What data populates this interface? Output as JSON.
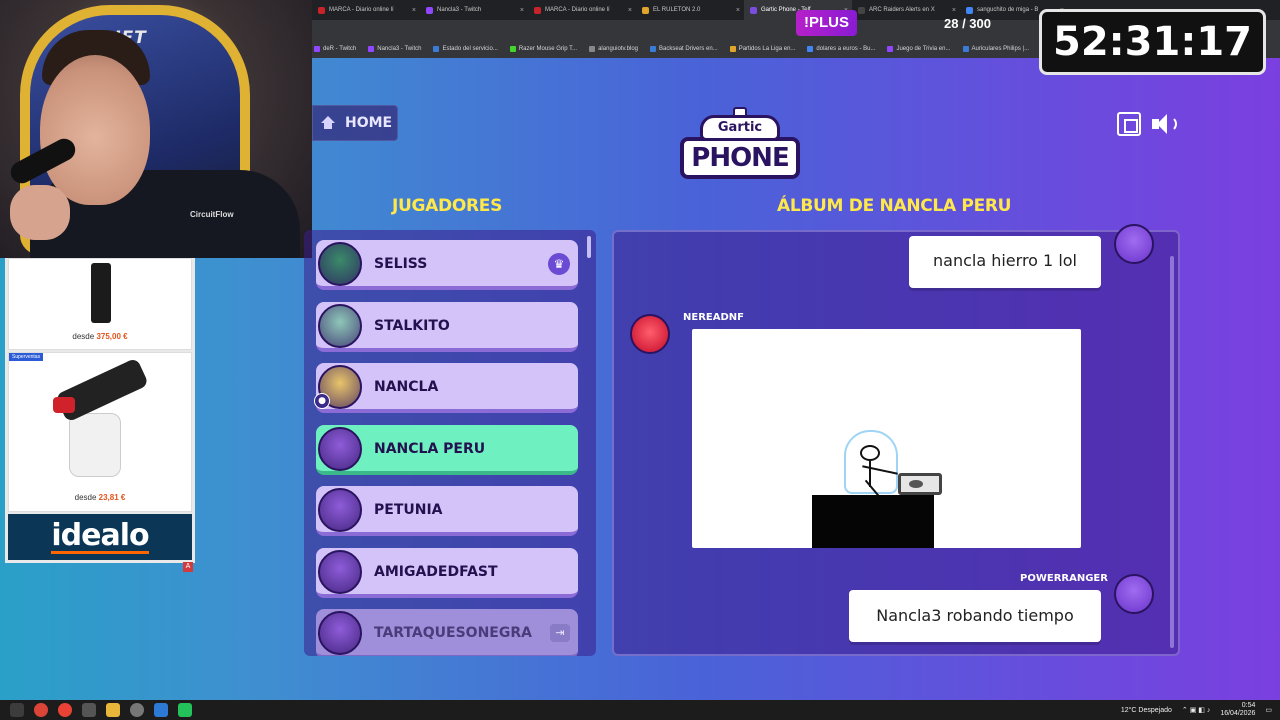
{
  "browser": {
    "tabs": [
      {
        "label": "MARCA - Diario online lí",
        "color": "#c9232a",
        "active": false
      },
      {
        "label": "Nancla3 - Twitch",
        "color": "#9146ff",
        "active": false
      },
      {
        "label": "MARCA - Diario online lí",
        "color": "#c9232a",
        "active": false
      },
      {
        "label": "EL RULETON 2.0",
        "color": "#e0a52a",
        "active": false
      },
      {
        "label": "Gartic Phone - Telf",
        "color": "#7a4de0",
        "active": true
      },
      {
        "label": "ARC Raiders Alerts en X",
        "color": "#444444",
        "active": false
      },
      {
        "label": "sanguchito de miga - B",
        "color": "#4285f4",
        "active": false
      }
    ],
    "bookmarks": [
      {
        "label": "deR - Twitch",
        "color": "#9146ff"
      },
      {
        "label": "Nancla3 - Twitch",
        "color": "#9146ff"
      },
      {
        "label": "Estado del servicio...",
        "color": "#3a7bd5"
      },
      {
        "label": "Razer Mouse Grip T...",
        "color": "#44d62c"
      },
      {
        "label": "alanguiotv.blog",
        "color": "#888888"
      },
      {
        "label": "Backseat Drivers en...",
        "color": "#3a7bd5"
      },
      {
        "label": "Partidos La Liga en...",
        "color": "#e0a52a"
      },
      {
        "label": "dolares a euros - Bu...",
        "color": "#4285f4"
      },
      {
        "label": "Juego de Trivia en...",
        "color": "#9146ff"
      },
      {
        "label": "Auriculares Philips |...",
        "color": "#3a7bd5"
      }
    ]
  },
  "webcam": {
    "chair_brand": "DRIFT",
    "shirt_brand": "CircuitFlow"
  },
  "ads": {
    "item1_price_prefix": "desde",
    "item1_price": "375,00 €",
    "item2_badge": "Superventas",
    "item2_price_prefix": "desde",
    "item2_price": "23,81 €",
    "brand": "idealo",
    "marker": "A"
  },
  "overlay": {
    "plus_label": "!PLUS",
    "counter": "28 / 300",
    "timer": "52:31:17"
  },
  "game": {
    "home_label": "HOME",
    "logo_top": "Gartic",
    "logo_bottom": "PHONE",
    "players_title": "JUGADORES",
    "album_title": "ÁLBUM DE NANCLA PERU",
    "players": [
      {
        "name": "SELISS",
        "state": "host",
        "avatar_color": "#3b8a6a"
      },
      {
        "name": "STALKITO",
        "state": "normal",
        "avatar_color": "#8fc7b8"
      },
      {
        "name": "NANCLA",
        "state": "normal",
        "avatar_color": "#e9c46a"
      },
      {
        "name": "NANCLA PERU",
        "state": "current",
        "avatar_color": "#8e5cd9"
      },
      {
        "name": "PETUNIA",
        "state": "normal",
        "avatar_color": "#8e5cd9"
      },
      {
        "name": "AMIGADEDFAST",
        "state": "normal",
        "avatar_color": "#8e5cd9"
      },
      {
        "name": "TARTAQUESONEGRA",
        "state": "left",
        "avatar_color": "#8e5cd9"
      }
    ],
    "album": {
      "first_text": "nancla hierro 1 lol",
      "drawing_author": "NEREADNF",
      "last_author": "POWERRANGER",
      "last_text": "Nancla3 robando tiempo"
    }
  },
  "taskbar": {
    "weather": "12°C Despejado",
    "time": "0:54",
    "date": "16/04/2026"
  },
  "colors": {
    "title_yellow": "#ffe84a",
    "current_player": "#6ff0c0",
    "player_card": "#d4c3f8"
  }
}
